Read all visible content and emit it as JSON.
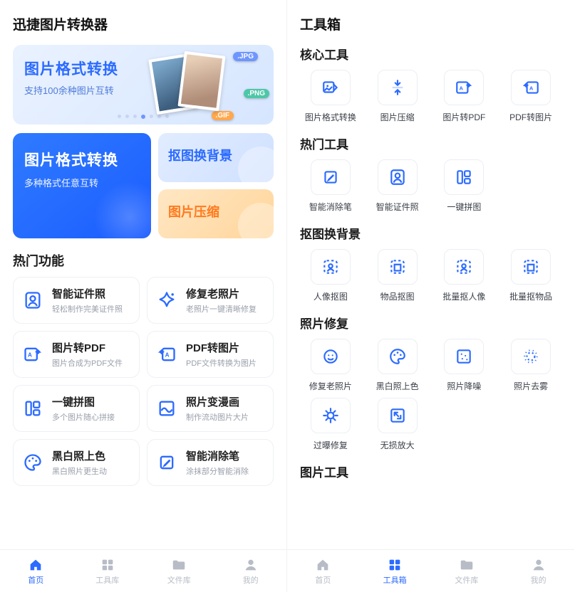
{
  "left": {
    "app_title": "迅捷图片转换器",
    "banner": {
      "title": "图片格式转换",
      "subtitle": "支持100余种图片互转",
      "tags": {
        "jpg": ".JPG",
        "png": ".PNG",
        "gif": ".GIF"
      }
    },
    "tiles": {
      "big": {
        "title": "图片格式转换",
        "sub": "多种格式任意互转"
      },
      "koutu": "抠图换背景",
      "yasuo": "图片压缩"
    },
    "hot_section": "热门功能",
    "hot": [
      {
        "title": "智能证件照",
        "sub": "轻松制作完美证件照",
        "icon": "person-frame-icon"
      },
      {
        "title": "修复老照片",
        "sub": "老照片一键清晰修复",
        "icon": "sparkle-bell-icon"
      },
      {
        "title": "图片转PDF",
        "sub": "图片合成为PDF文件",
        "icon": "image-pdf-icon"
      },
      {
        "title": "PDF转图片",
        "sub": "PDF文件转换为图片",
        "icon": "pdf-image-icon"
      },
      {
        "title": "一键拼图",
        "sub": "多个图片随心拼接",
        "icon": "collage-icon"
      },
      {
        "title": "照片变漫画",
        "sub": "制作流动图片大片",
        "icon": "wave-image-icon"
      },
      {
        "title": "黑白照上色",
        "sub": "黑白照片更生动",
        "icon": "palette-icon"
      },
      {
        "title": "智能消除笔",
        "sub": "涂抹部分智能消除",
        "icon": "eraser-pen-icon"
      }
    ],
    "nav": [
      {
        "label": "首页",
        "icon": "home-icon",
        "active": true
      },
      {
        "label": "工具库",
        "icon": "grid-icon",
        "active": false
      },
      {
        "label": "文件库",
        "icon": "folder-icon",
        "active": false
      },
      {
        "label": "我的",
        "icon": "user-icon",
        "active": false
      }
    ]
  },
  "right": {
    "page_title": "工具箱",
    "sections": {
      "core": {
        "title": "核心工具",
        "items": [
          {
            "label": "图片格式转换",
            "icon": "convert-icon"
          },
          {
            "label": "图片压缩",
            "icon": "compress-icon"
          },
          {
            "label": "图片转PDF",
            "icon": "image-pdf-icon"
          },
          {
            "label": "PDF转图片",
            "icon": "pdf-image-icon"
          }
        ]
      },
      "hot": {
        "title": "热门工具",
        "items": [
          {
            "label": "智能消除笔",
            "icon": "eraser-pen-icon"
          },
          {
            "label": "智能证件照",
            "icon": "person-frame-icon"
          },
          {
            "label": "一键拼图",
            "icon": "collage-icon"
          }
        ]
      },
      "koutu": {
        "title": "抠图换背景",
        "items": [
          {
            "label": "人像抠图",
            "icon": "portrait-cutout-icon"
          },
          {
            "label": "物品抠图",
            "icon": "object-cutout-icon"
          },
          {
            "label": "批量抠人像",
            "icon": "batch-portrait-icon"
          },
          {
            "label": "批量抠物品",
            "icon": "batch-object-icon"
          }
        ]
      },
      "repair": {
        "title": "照片修复",
        "items": [
          {
            "label": "修复老照片",
            "icon": "face-restore-icon"
          },
          {
            "label": "黑白照上色",
            "icon": "palette-icon"
          },
          {
            "label": "照片降噪",
            "icon": "denoise-icon"
          },
          {
            "label": "照片去雾",
            "icon": "dehaze-icon"
          },
          {
            "label": "过曝修复",
            "icon": "exposure-icon"
          },
          {
            "label": "无损放大",
            "icon": "upscale-icon"
          }
        ]
      },
      "image_tools": {
        "title": "图片工具"
      }
    },
    "nav": [
      {
        "label": "首页",
        "icon": "home-icon",
        "active": false
      },
      {
        "label": "工具箱",
        "icon": "grid-icon",
        "active": true
      },
      {
        "label": "文件库",
        "icon": "folder-icon",
        "active": false
      },
      {
        "label": "我的",
        "icon": "user-icon",
        "active": false
      }
    ]
  }
}
